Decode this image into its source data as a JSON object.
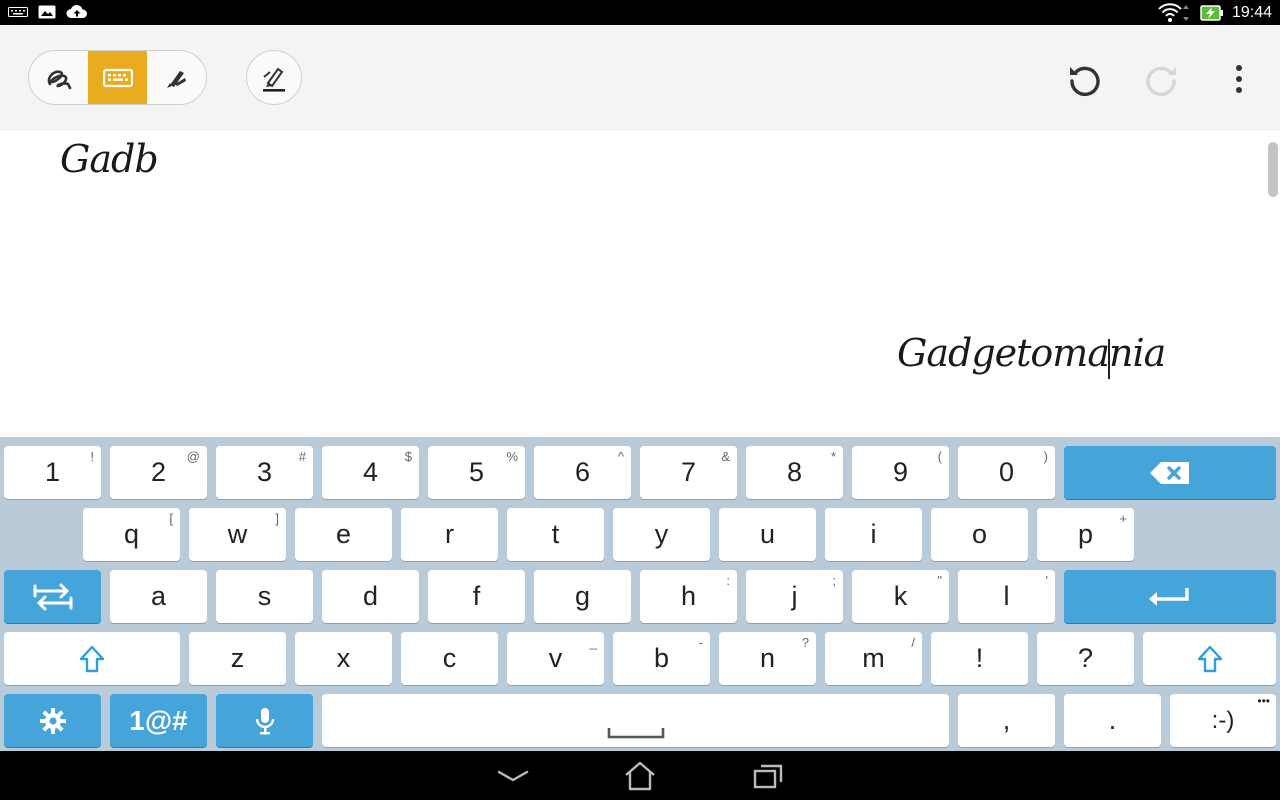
{
  "status_bar": {
    "time": "19:44",
    "left_icons": [
      "keyboard-icon",
      "image-notification-icon",
      "cloud-upload-icon"
    ],
    "right_icons": [
      "wifi-icon",
      "battery-charging-icon"
    ]
  },
  "toolbar": {
    "modes": [
      {
        "name": "handwriting-mode",
        "icon": "squiggle-icon",
        "active": false
      },
      {
        "name": "keyboard-mode",
        "icon": "keyboard-icon",
        "active": true
      },
      {
        "name": "brush-mode",
        "icon": "brush-icon",
        "active": false
      }
    ],
    "pen_style_icon": "pen-underline-icon",
    "undo_icon": "undo-icon",
    "redo_icon": "redo-icon",
    "overflow_icon": "more-vertical-icon",
    "accent_color": "#e8ac1e"
  },
  "canvas": {
    "text_1": "Gadb",
    "text_2": "Gadgetomania"
  },
  "keyboard": {
    "row1": [
      {
        "label": "1",
        "hint": "!"
      },
      {
        "label": "2",
        "hint": "@"
      },
      {
        "label": "3",
        "hint": "#"
      },
      {
        "label": "4",
        "hint": "$"
      },
      {
        "label": "5",
        "hint": "%"
      },
      {
        "label": "6",
        "hint": "^"
      },
      {
        "label": "7",
        "hint": "&"
      },
      {
        "label": "8",
        "hint": "*"
      },
      {
        "label": "9",
        "hint": "("
      },
      {
        "label": "0",
        "hint": ")"
      }
    ],
    "row2": [
      {
        "label": "q",
        "hint": "["
      },
      {
        "label": "w",
        "hint": "]"
      },
      {
        "label": "e",
        "hint": ""
      },
      {
        "label": "r",
        "hint": ""
      },
      {
        "label": "t",
        "hint": ""
      },
      {
        "label": "y",
        "hint": ""
      },
      {
        "label": "u",
        "hint": ""
      },
      {
        "label": "i",
        "hint": ""
      },
      {
        "label": "o",
        "hint": ""
      },
      {
        "label": "p",
        "hint": "+"
      }
    ],
    "row3": [
      {
        "label": "a",
        "hint": ""
      },
      {
        "label": "s",
        "hint": ""
      },
      {
        "label": "d",
        "hint": ""
      },
      {
        "label": "f",
        "hint": ""
      },
      {
        "label": "g",
        "hint": ""
      },
      {
        "label": "h",
        "hint": ":"
      },
      {
        "label": "j",
        "hint": ";"
      },
      {
        "label": "k",
        "hint": "\""
      },
      {
        "label": "l",
        "hint": "'"
      }
    ],
    "row4": [
      {
        "label": "z",
        "hint": ""
      },
      {
        "label": "x",
        "hint": ""
      },
      {
        "label": "c",
        "hint": ""
      },
      {
        "label": "v",
        "hint": "_"
      },
      {
        "label": "b",
        "hint": "-"
      },
      {
        "label": "n",
        "hint": "?"
      },
      {
        "label": "m",
        "hint": "/"
      },
      {
        "label": "!",
        "hint": ""
      },
      {
        "label": "?",
        "hint": ""
      }
    ],
    "symbols_key": "1@#",
    "comma_key": ",",
    "period_key": ".",
    "emoji_key": ":-)",
    "emoji_hint": "•••",
    "key_color_blue": "#45a4d9",
    "background_color": "#b9cbd8"
  },
  "nav_bar": {
    "icons": [
      "back-icon",
      "home-icon",
      "recent-apps-icon"
    ]
  }
}
